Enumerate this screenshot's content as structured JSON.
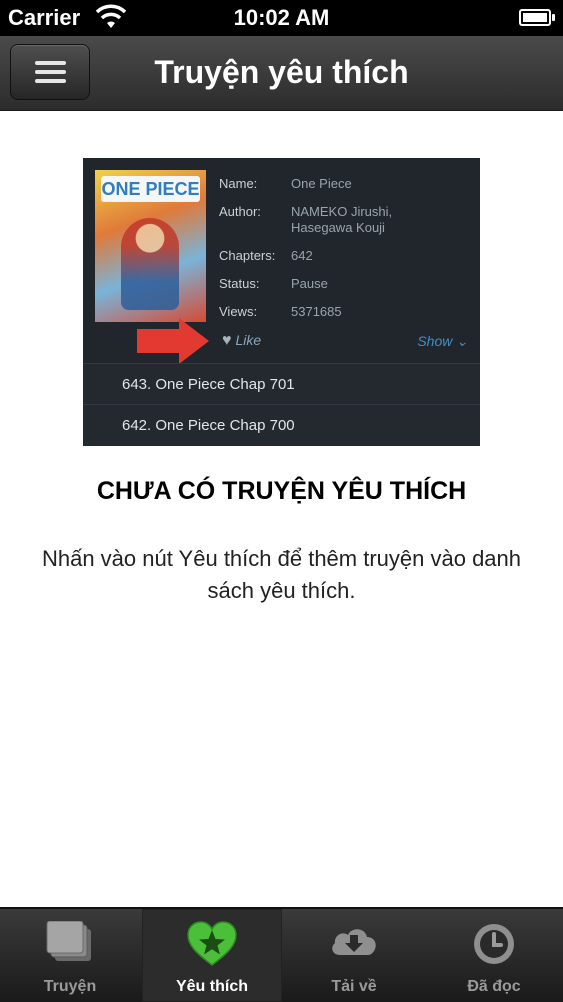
{
  "status_bar": {
    "carrier": "Carrier",
    "time": "10:02 AM"
  },
  "nav": {
    "title": "Truyện yêu thích",
    "menu_icon": "hamburger-menu-icon"
  },
  "illustration": {
    "cover_logo": "ONE PIECE",
    "rows": [
      {
        "key": "Name:",
        "value": "One Piece"
      },
      {
        "key": "Author:",
        "value": "NAMEKO Jirushi, Hasegawa Kouji"
      },
      {
        "key": "Chapters:",
        "value": "642"
      },
      {
        "key": "Status:",
        "value": "Pause"
      },
      {
        "key": "Views:",
        "value": "5371685"
      }
    ],
    "like_label": "Like",
    "show_label": "Show",
    "chapters": [
      "643. One Piece Chap 701",
      "642. One Piece Chap 700"
    ]
  },
  "empty_state": {
    "title": "CHƯA CÓ TRUYỆN YÊU THÍCH",
    "description": "Nhấn vào nút Yêu thích để thêm truyện vào danh sách yêu thích."
  },
  "tabs": [
    {
      "label": "Truyện",
      "icon": "book-stack-icon",
      "active": false
    },
    {
      "label": "Yêu thích",
      "icon": "star-heart-icon",
      "active": true
    },
    {
      "label": "Tải về",
      "icon": "cloud-download-icon",
      "active": false
    },
    {
      "label": "Đã đọc",
      "icon": "clock-icon",
      "active": false
    }
  ],
  "colors": {
    "nav_bg": "#2c2c2c",
    "accent_green": "#4cbf3a",
    "arrow_red": "#e23a30",
    "link_blue": "#3f8fc8"
  }
}
